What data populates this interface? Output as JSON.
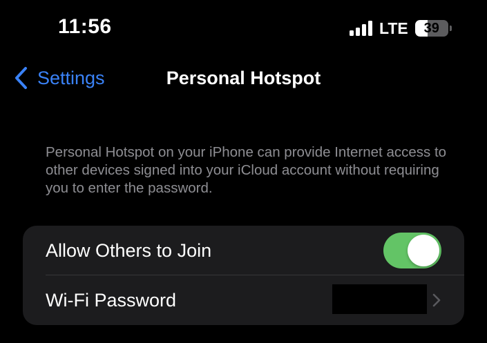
{
  "status_bar": {
    "time": "11:56",
    "network": "LTE",
    "battery_level": "39",
    "battery_fraction": 0.39,
    "signal_icon": "cellular-signal-icon",
    "battery_icon": "battery-icon"
  },
  "nav": {
    "back_label": "Settings",
    "back_icon": "chevron-left-icon",
    "title": "Personal Hotspot"
  },
  "description": "Personal Hotspot on your iPhone can provide Internet access to other devices signed into your iCloud account without requiring you to enter the password.",
  "settings": {
    "allow_others": {
      "label": "Allow Others to Join",
      "enabled": true
    },
    "wifi_password": {
      "label": "Wi-Fi Password",
      "value_redacted": true,
      "accessory_icon": "chevron-right-icon"
    }
  },
  "colors": {
    "accent": "#3a82f7",
    "toggle_on": "#63c466",
    "background": "#000000",
    "group_background": "#1c1c1e",
    "secondary_text": "#8e8e93"
  }
}
